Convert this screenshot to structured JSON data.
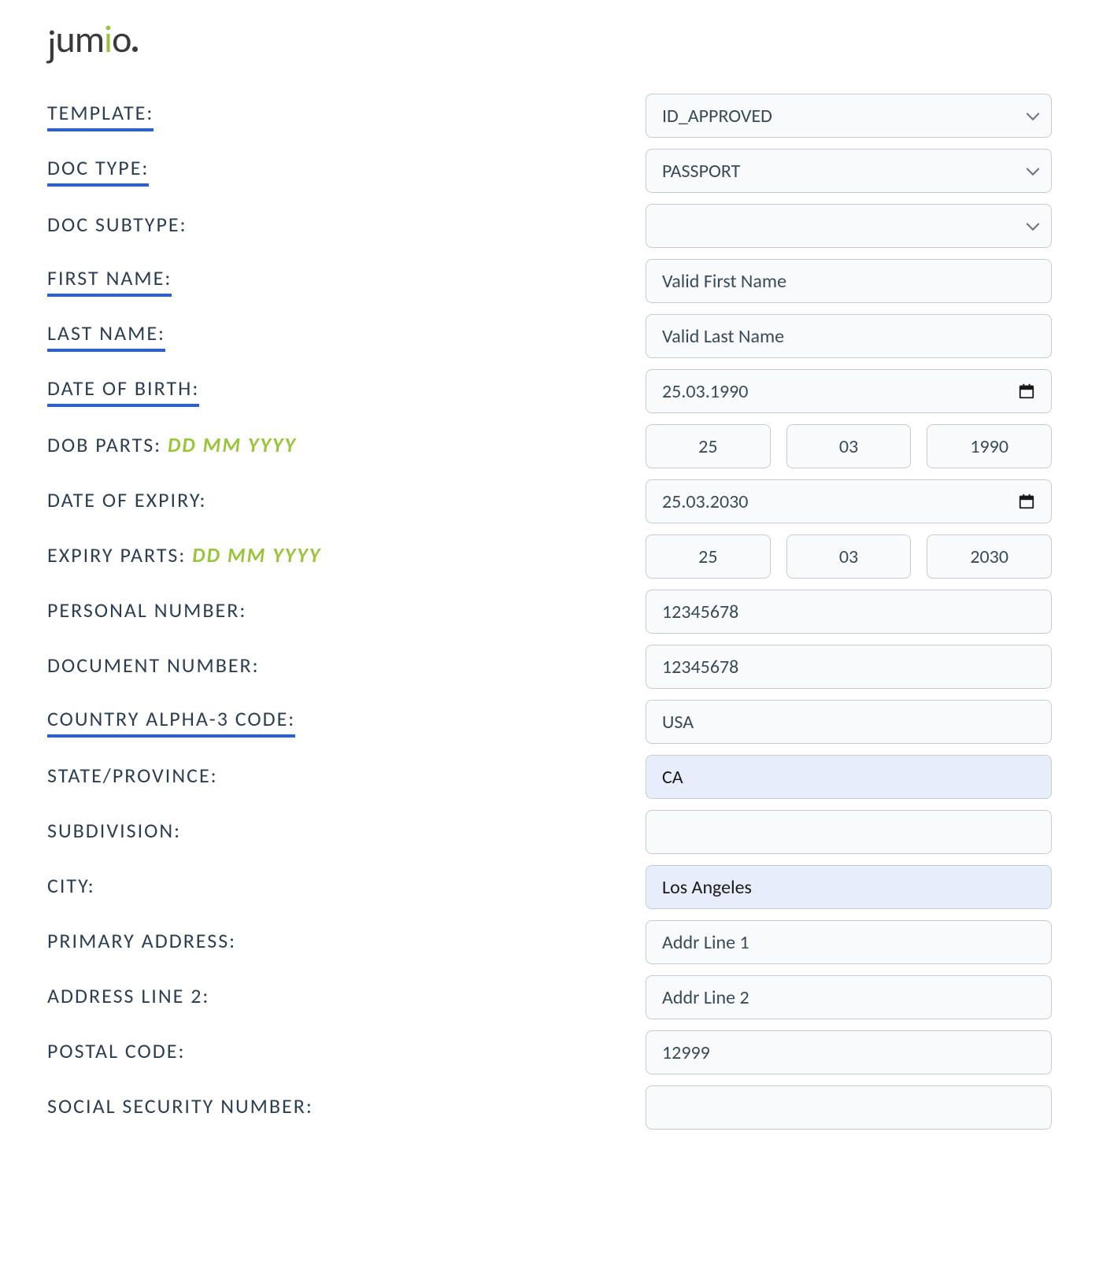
{
  "logo": {
    "text": "jumio"
  },
  "labels": {
    "template": "Template:",
    "doc_type": "Doc type:",
    "doc_subtype": "Doc subtype:",
    "first_name": "First name:",
    "last_name": "Last name:",
    "dob": "Date of Birth:",
    "dob_parts": "DOB Parts:",
    "date_hint": "DD MM YYYY",
    "expiry": "Date of Expiry:",
    "expiry_parts": "Expiry Parts:",
    "personal_number": "Personal Number:",
    "document_number": "Document Number:",
    "country_code": "Country Alpha-3 Code:",
    "state": "State/Province:",
    "subdivision": "Subdivision:",
    "city": "City:",
    "primary_address": "Primary Address:",
    "address_line2": "Address Line 2:",
    "postal_code": "Postal code:",
    "ssn": "Social Security Number:"
  },
  "values": {
    "template": "ID_APPROVED",
    "doc_type": "PASSPORT",
    "doc_subtype": "",
    "first_name": "Valid First Name",
    "last_name": "Valid Last Name",
    "dob": "25.03.1990",
    "dob_dd": "25",
    "dob_mm": "03",
    "dob_yyyy": "1990",
    "expiry": "25.03.2030",
    "exp_dd": "25",
    "exp_mm": "03",
    "exp_yyyy": "2030",
    "personal_number": "12345678",
    "document_number": "12345678",
    "country_code": "USA",
    "state": "CA",
    "subdivision": "",
    "city": "Los Angeles",
    "primary_address": "Addr Line 1",
    "address_line2": "Addr Line 2",
    "postal_code": "12999",
    "ssn": ""
  }
}
